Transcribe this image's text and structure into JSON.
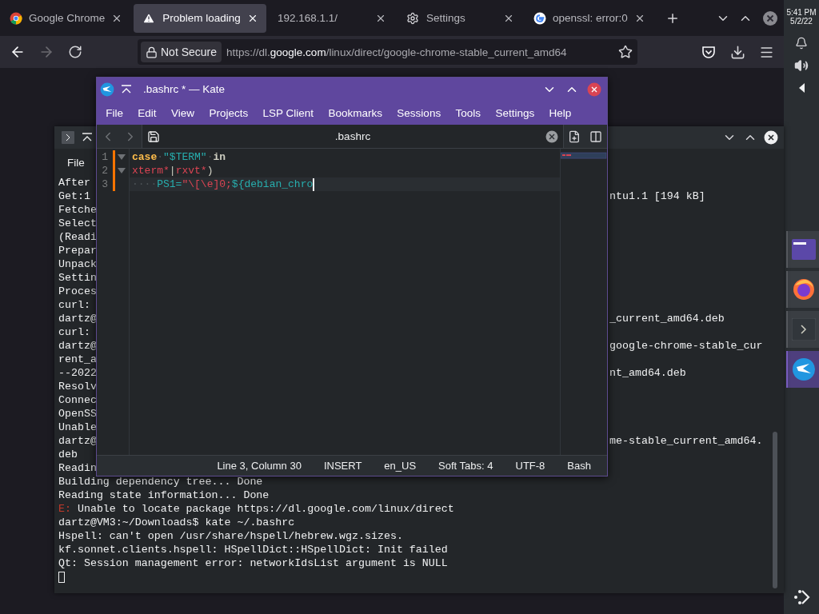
{
  "browser": {
    "tabs": [
      {
        "kind": "chrome",
        "label": "Google Chrome",
        "selected": false
      },
      {
        "kind": "warning",
        "label": "Problem loading",
        "selected": true
      },
      {
        "kind": "plain",
        "label": "192.168.1.1/",
        "selected": false
      },
      {
        "kind": "settings",
        "label": "Settings",
        "selected": false
      },
      {
        "kind": "google",
        "label": "openssl: error:0",
        "selected": false
      }
    ],
    "back_disabled": false,
    "forward_disabled": true,
    "security": "Not Secure",
    "url": {
      "before": "https://dl.",
      "domain": "google.com",
      "after": "/linux/direct/google-chrome-stable_current_amd64"
    }
  },
  "terminal": {
    "menu": [
      "File"
    ],
    "lines": [
      {
        "kind": "split",
        "left": "After"
      },
      {
        "kind": "split",
        "left": "Get:1",
        "right": "ntu1.1 [194 kB]"
      },
      {
        "kind": "split",
        "left": "Fetche"
      },
      {
        "kind": "split",
        "left": "Select"
      },
      {
        "kind": "split",
        "left": "(Readi"
      },
      {
        "kind": "split",
        "left": "Prepar"
      },
      {
        "kind": "split",
        "left": "Unpack"
      },
      {
        "kind": "split",
        "left": "Settin"
      },
      {
        "kind": "split",
        "left": "Proces"
      },
      {
        "kind": "split",
        "left": "curl:"
      },
      {
        "kind": "split",
        "left": "dartz@",
        "right": "_current_amd64.deb"
      },
      {
        "kind": "split",
        "left": "curl:"
      },
      {
        "kind": "split",
        "left": "dartz@",
        "right": "google-chrome-stable_cur"
      },
      {
        "kind": "split",
        "left": "rent_a"
      },
      {
        "kind": "split",
        "left": "--2022",
        "right": "nt_amd64.deb"
      },
      {
        "kind": "split",
        "left": "Resolv"
      },
      {
        "kind": "split",
        "left": "Connec"
      },
      {
        "kind": "split",
        "left": "OpenSS"
      },
      {
        "kind": "split",
        "left": "Unable"
      },
      {
        "kind": "split",
        "left": "dartz@",
        "right": "me-stable_current_amd64."
      },
      {
        "kind": "split",
        "left": "deb"
      },
      {
        "kind": "split",
        "left": "Readin"
      },
      {
        "kind": "full",
        "text": "Building dependency tree... Done"
      },
      {
        "kind": "full",
        "text": "Reading state information... Done"
      },
      {
        "kind": "error",
        "prefix": "E:",
        "text": " Unable to locate package https://dl.google.com/linux/direct"
      },
      {
        "kind": "full",
        "text": "dartz@VM3:~/Downloads$ kate ~/.bashrc"
      },
      {
        "kind": "full",
        "text": "Hspell: can't open /usr/share/hspell/hebrew.wgz.sizes."
      },
      {
        "kind": "full",
        "text": "kf.sonnet.clients.hspell: HSpellDict::HSpellDict: Init failed"
      },
      {
        "kind": "full",
        "text": "Qt: Session management error: networkIdsList argument is NULL"
      },
      {
        "kind": "cursor"
      }
    ]
  },
  "kate": {
    "title": ".bashrc * — Kate",
    "menu": [
      "File",
      "Edit",
      "View",
      "Projects",
      "LSP Client",
      "Bookmarks",
      "Sessions",
      "Tools",
      "Settings",
      "Help"
    ],
    "document": ".bashrc",
    "lines": [
      {
        "number": "1",
        "modified": true,
        "foldable": true,
        "current": false,
        "tokens": [
          {
            "kind": "keyword",
            "text": "case"
          },
          {
            "kind": "space",
            "text": "·"
          },
          {
            "kind": "string",
            "text": "\"$TERM\""
          },
          {
            "kind": "space",
            "text": "·"
          },
          {
            "kind": "bold",
            "text": "in"
          }
        ]
      },
      {
        "number": "2",
        "modified": true,
        "foldable": true,
        "current": false,
        "tokens": [
          {
            "kind": "pattern",
            "text": "xterm*"
          },
          {
            "kind": "plain",
            "text": "|"
          },
          {
            "kind": "pattern",
            "text": "rxvt*"
          },
          {
            "kind": "plain",
            "text": ")"
          }
        ]
      },
      {
        "number": "3",
        "modified": true,
        "foldable": false,
        "current": true,
        "tokens": [
          {
            "kind": "space",
            "text": "····"
          },
          {
            "kind": "string",
            "text": "PS1="
          },
          {
            "kind": "pattern",
            "text": "\"\\[\\e]0;"
          },
          {
            "kind": "string",
            "text": "${debian_chro"
          }
        ]
      }
    ],
    "status": [
      "Line 3, Column 30",
      "INSERT",
      "en_US",
      "Soft Tabs: 4",
      "UTF-8",
      "Bash"
    ]
  },
  "panel": {
    "time": "5:41 PM",
    "date": "5/2/22",
    "tasks": [
      {
        "kind": "folder",
        "selected": false
      },
      {
        "kind": "firefox",
        "selected": false
      },
      {
        "kind": "terminal",
        "selected": false
      },
      {
        "kind": "kate",
        "selected": true
      }
    ]
  }
}
